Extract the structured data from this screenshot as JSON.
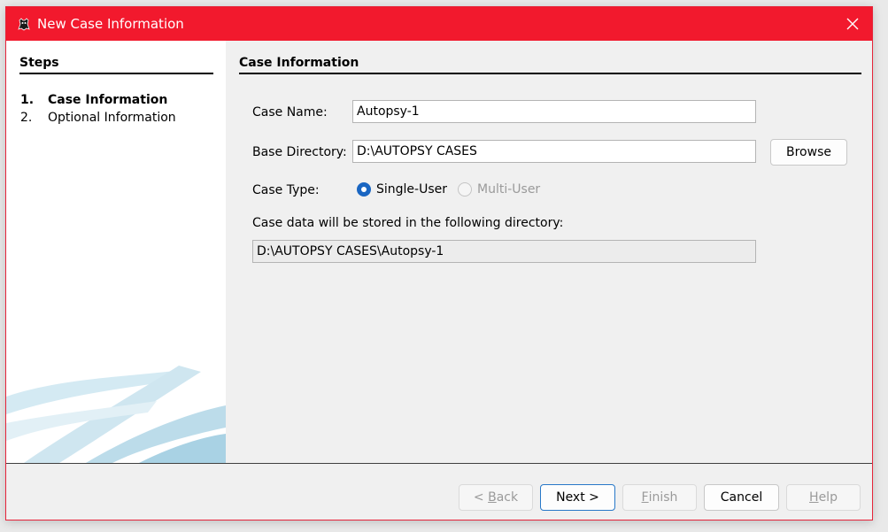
{
  "window": {
    "title": "New Case Information",
    "accent_color": "#f2192d",
    "app_icon": "autopsy-dog-icon",
    "close_icon": "close-icon"
  },
  "steps": {
    "header": "Steps",
    "items": [
      {
        "number": "1.",
        "label": "Case Information",
        "active": true
      },
      {
        "number": "2.",
        "label": "Optional Information",
        "active": false
      }
    ]
  },
  "case_info": {
    "header": "Case Information",
    "case_name_label": "Case Name:",
    "case_name_value": "Autopsy-1",
    "base_dir_label": "Base Directory:",
    "base_dir_value": "D:\\AUTOPSY CASES",
    "browse_label": "Browse",
    "case_type_label": "Case Type:",
    "single_user_label": "Single-User",
    "single_user_selected": true,
    "multi_user_label": "Multi-User",
    "multi_user_enabled": false,
    "storage_label": "Case data will be stored in the following directory:",
    "storage_path": "D:\\AUTOPSY CASES\\Autopsy-1"
  },
  "footer": {
    "back": {
      "prefix": "< ",
      "mnemonic": "B",
      "rest": "ack",
      "enabled": false
    },
    "next": {
      "label": "Next >",
      "enabled": true
    },
    "finish": {
      "mnemonic": "F",
      "rest": "inish",
      "enabled": false
    },
    "cancel": {
      "label": "Cancel",
      "enabled": true
    },
    "help": {
      "mnemonic": "H",
      "rest": "elp",
      "enabled": false
    }
  }
}
